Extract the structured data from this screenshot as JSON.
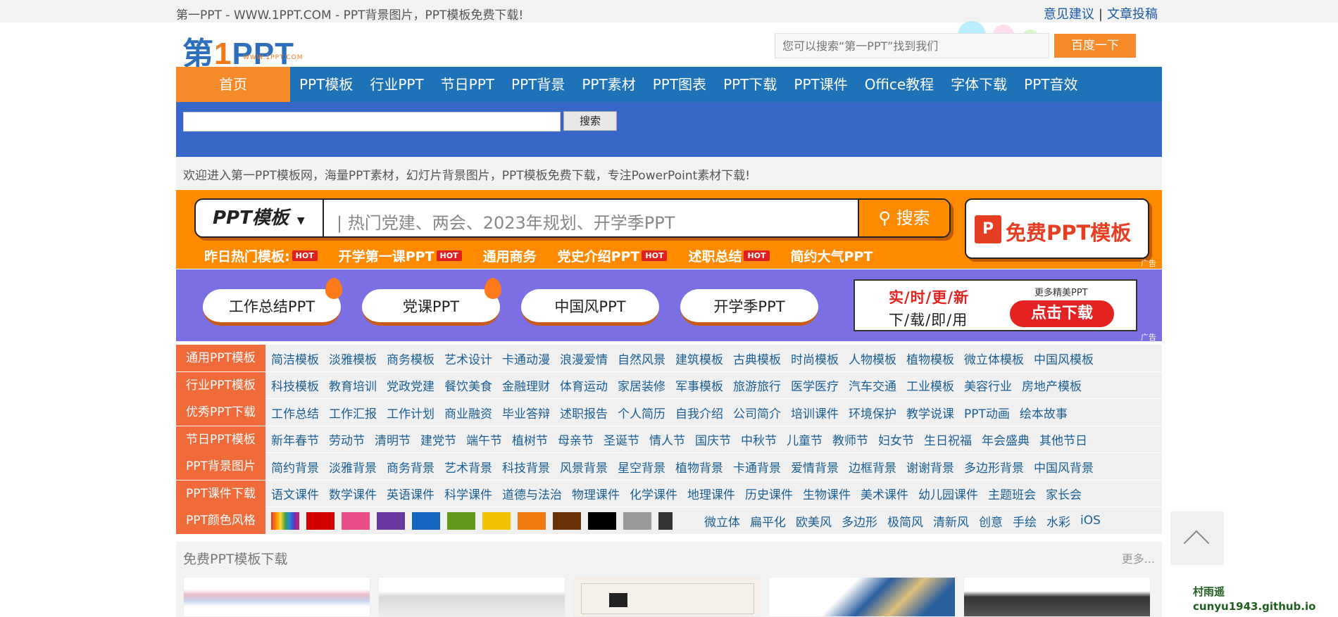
{
  "topbar": {
    "tagline": "第一PPT - WWW.1PPT.COM - PPT背景图片，PPT模板免费下载!",
    "links": [
      "意见建议",
      "文章投稿"
    ],
    "separator": "|"
  },
  "logo": {
    "text_a": "第",
    "text_one": "1",
    "text_b": "PPT",
    "url": "WWW.1PPT.COM"
  },
  "header_search": {
    "placeholder": "您可以搜索“第一PPT”找到我们",
    "button": "百度一下"
  },
  "nav": {
    "home": "首页",
    "items": [
      "PPT模板",
      "行业PPT",
      "节日PPT",
      "PPT背景",
      "PPT素材",
      "PPT图表",
      "PPT下载",
      "PPT课件",
      "Office教程",
      "字体下载",
      "PPT音效"
    ]
  },
  "site_search": {
    "button": "搜索"
  },
  "welcome": "欢迎进入第一PPT模板网，海量PPT素材，幻灯片背景图片，PPT模板免费下载，专注PowerPoint素材下载!",
  "ad_search": {
    "category": "PPT模板",
    "placeholder": "热门党建、两会、2023年规划、开学季PPT",
    "button": "搜索",
    "hot_label": "昨日热门模板:",
    "hot_badge": "HOT",
    "hot_items": [
      "第一课PPT",
      "通用商务",
      "党史介绍PPT",
      "述职总结",
      "简约大气PPT"
    ],
    "hot_item_0_prefix": "开学",
    "free_button": "免费PPT模板",
    "ad_tag": "广告"
  },
  "promo": {
    "pills": [
      "工作总结PPT",
      "党课PPT",
      "中国风PPT",
      "开学季PPT"
    ],
    "line1": "实/时/更/新",
    "line2": "下/载/即/用",
    "more": "更多精美PPT",
    "download": "点击下载",
    "ad_tag": "广告"
  },
  "categories": [
    {
      "label": "通用PPT模板",
      "links": [
        "简洁模板",
        "淡雅模板",
        "商务模板",
        "艺术设计",
        "卡通动漫",
        "浪漫爱情",
        "自然风景",
        "建筑模板",
        "古典模板",
        "时尚模板",
        "人物模板",
        "植物模板",
        "微立体模板",
        "中国风模板"
      ]
    },
    {
      "label": "行业PPT模板",
      "links": [
        "科技模板",
        "教育培训",
        "党政党建",
        "餐饮美食",
        "金融理财",
        "体育运动",
        "家居装修",
        "军事模板",
        "旅游旅行",
        "医学医疗",
        "汽车交通",
        "工业模板",
        "美容行业",
        "房地产模板"
      ]
    },
    {
      "label": "优秀PPT下载",
      "links": [
        "工作总结",
        "工作汇报",
        "工作计划",
        "商业融资",
        "毕业答辩",
        "述职报告",
        "个人简历",
        "自我介绍",
        "公司简介",
        "培训课件",
        "环境保护",
        "教学说课",
        "PPT动画",
        "绘本故事"
      ]
    },
    {
      "label": "节日PPT模板",
      "links": [
        "新年春节",
        "劳动节",
        "清明节",
        "建党节",
        "端午节",
        "植树节",
        "母亲节",
        "圣诞节",
        "情人节",
        "国庆节",
        "中秋节",
        "儿童节",
        "教师节",
        "妇女节",
        "生日祝福",
        "年会盛典",
        "其他节日"
      ]
    },
    {
      "label": "PPT背景图片",
      "links": [
        "简约背景",
        "淡雅背景",
        "商务背景",
        "艺术背景",
        "科技背景",
        "风景背景",
        "星空背景",
        "植物背景",
        "卡通背景",
        "爱情背景",
        "边框背景",
        "谢谢背景",
        "多边形背景",
        "中国风背景"
      ]
    },
    {
      "label": "PPT课件下载",
      "links": [
        "语文课件",
        "数学课件",
        "英语课件",
        "科学课件",
        "道德与法治",
        "物理课件",
        "化学课件",
        "地理课件",
        "历史课件",
        "生物课件",
        "美术课件",
        "幼儿园课件",
        "主题班会",
        "家长会"
      ]
    }
  ],
  "color_row": {
    "label": "PPT颜色风格",
    "swatch_colors": [
      "rainbow",
      "#d40000",
      "#e94e8a",
      "#6a3aa2",
      "#1565c0",
      "#5f9a1a",
      "#f2c200",
      "#f07a10",
      "#6a3208",
      "#000000",
      "#999999",
      "#333333"
    ],
    "links": [
      "微立体",
      "扁平化",
      "欧美风",
      "多边形",
      "极简风",
      "清新风",
      "创意",
      "手绘",
      "水彩",
      "iOS"
    ]
  },
  "section": {
    "title": "免费PPT模板下载",
    "more": "更多..."
  },
  "watermark": {
    "line1": "村雨遥",
    "line2": "cunyu1943.github.io"
  }
}
